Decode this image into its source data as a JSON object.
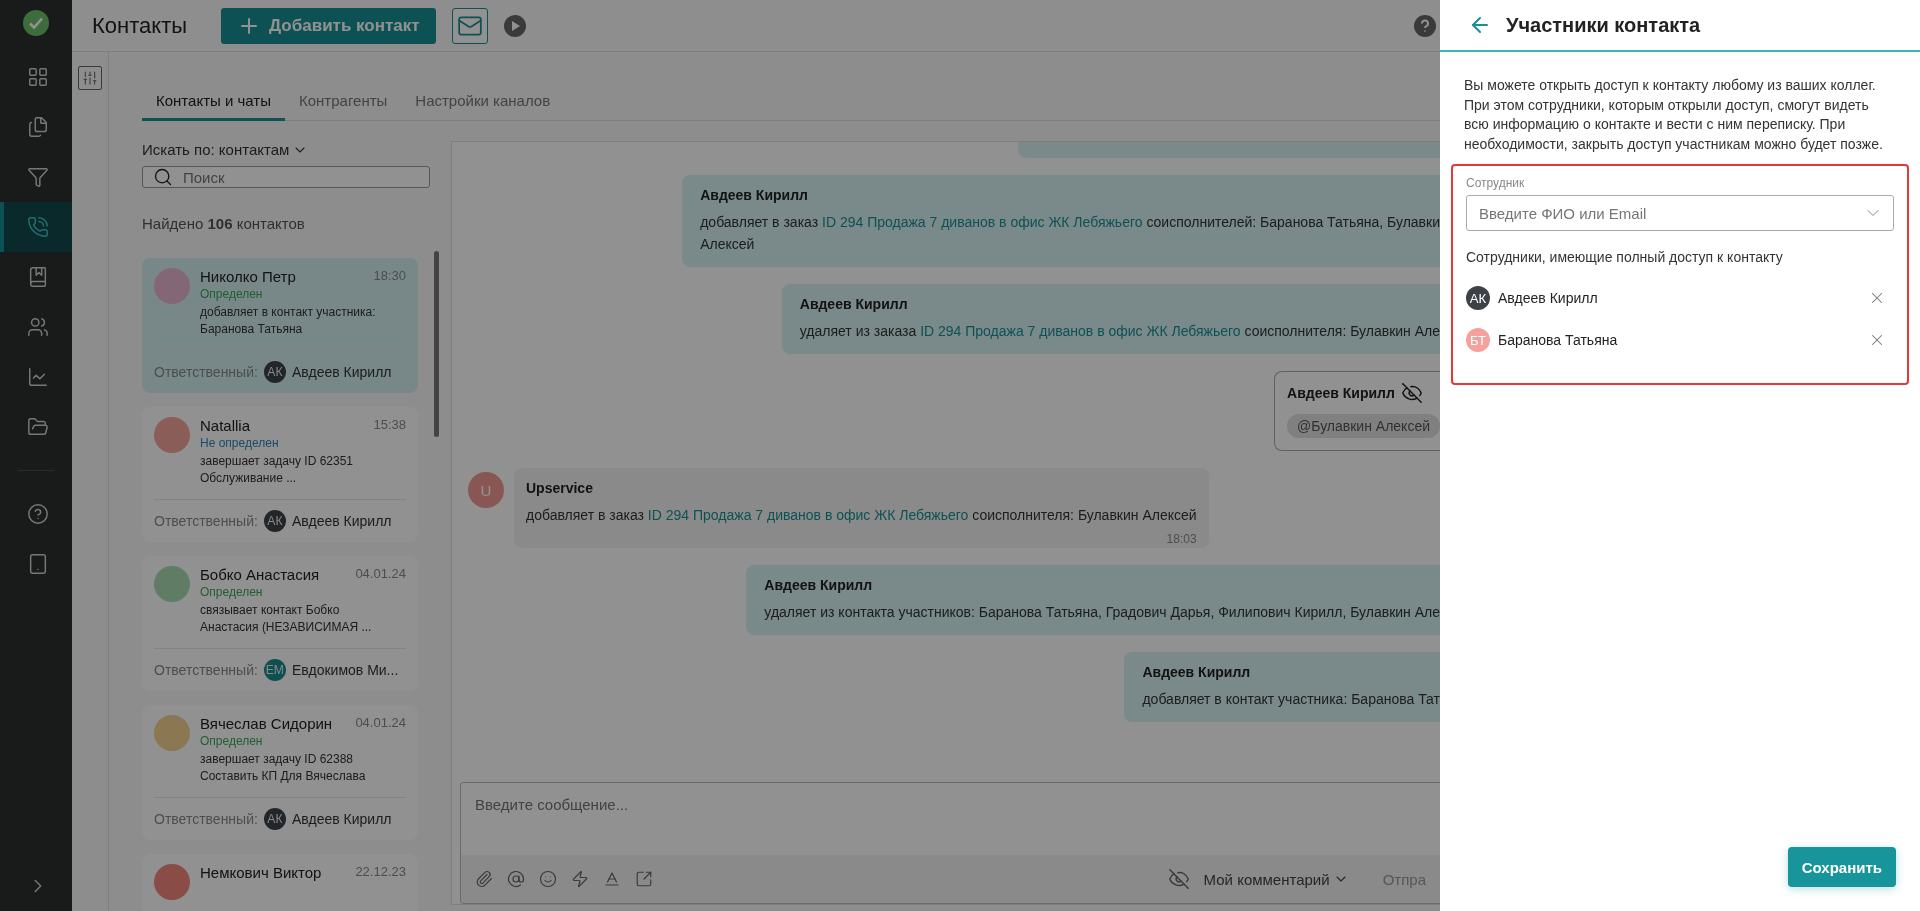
{
  "nav": {
    "items": [
      {
        "kind": "grid",
        "selected": false
      },
      {
        "kind": "documents",
        "selected": false
      },
      {
        "kind": "funnel",
        "selected": false
      },
      {
        "kind": "phone",
        "selected": true
      },
      {
        "kind": "book",
        "selected": false
      },
      {
        "kind": "people",
        "selected": false
      },
      {
        "kind": "chart",
        "selected": false
      },
      {
        "kind": "folder",
        "selected": false
      }
    ],
    "bottom_items": [
      {
        "kind": "help",
        "selected": false
      },
      {
        "kind": "tablet",
        "selected": false
      }
    ]
  },
  "header": {
    "title": "Контакты",
    "add_button": "Добавить контакт"
  },
  "tabs": [
    {
      "label": "Контакты и чаты",
      "selected": true
    },
    {
      "label": "Контрагенты",
      "selected": false
    },
    {
      "label": "Настройки каналов",
      "selected": false
    }
  ],
  "search_by": "Искать по: контактам",
  "search": {
    "placeholder": "Поиск"
  },
  "found": "Найдено **106** контактов",
  "contacts": [
    {
      "name": "Николко Петр",
      "time": "18:30",
      "status": "Определен",
      "known": true,
      "snippet": "добавляет в контакт участника: Баранова Татьяна",
      "color": "#846776",
      "selected": true,
      "responsible_label": "Ответственный:",
      "responsible": {
        "initials": "АК",
        "name": "Авдеев Кирилл",
        "color": "#232629"
      }
    },
    {
      "name": "Natallia",
      "time": "15:38",
      "status": "Не определен",
      "known": false,
      "snippet": "завершает задачу ID 62351 Обслуживание ...",
      "color": "#8a5d59",
      "selected": false,
      "responsible_label": "Ответственный:",
      "responsible": {
        "initials": "АК",
        "name": "Авдеев Кирилл",
        "color": "#232629"
      }
    },
    {
      "name": "Бобко Анастасия",
      "time": "04.01.24",
      "status": "Определен",
      "known": true,
      "snippet": "связывает контакт Бобко Анастасия (НЕЗАВИСИМАЯ ...",
      "color": "#607c65",
      "selected": false,
      "responsible_label": "Ответственный:",
      "responsible": {
        "initials": "ЕМ",
        "name": "Евдокимов Ми...",
        "color": "#0f4f50"
      }
    },
    {
      "name": "Вячеслав Сидорин",
      "time": "04.01.24",
      "status": "Определен",
      "known": true,
      "snippet": "завершает задачу ID 62388 Составить КП Для Вячеслава",
      "color": "#8c7753",
      "selected": false,
      "responsible_label": "Ответственный:",
      "responsible": {
        "initials": "АК",
        "name": "Авдеев Кирилл",
        "color": "#232629"
      }
    },
    {
      "name": "Немкович Виктор",
      "time": "22.12.23",
      "color": "#894c46",
      "selected": false
    }
  ],
  "chat": {
    "messages": [
      {
        "kind": "fragment"
      },
      {
        "kind": "outgoing",
        "author": "Авдеев Кирилл",
        "lines": [
          [
            {
              "text": "добавляет в заказ "
            },
            {
              "text": "ID 294 Продажа 7 диванов в офис ЖК Лебяжьего",
              "link": true
            },
            {
              "text": " соисполнителей: Баранова Татьяна, Булавки"
            }
          ],
          [
            {
              "text": "Алексей"
            }
          ]
        ]
      },
      {
        "kind": "outgoing",
        "author": "Авдеев Кирилл",
        "lines": [
          [
            {
              "text": "удаляет из заказа "
            },
            {
              "text": "ID 294 Продажа 7 диванов в офис ЖК Лебяжьего",
              "link": true
            },
            {
              "text": " соисполнителя: Булавкин Але"
            }
          ]
        ]
      },
      {
        "kind": "comment",
        "author": "Авдеев Кирилл",
        "mention": "@Булавкин Алексей"
      },
      {
        "kind": "incoming",
        "author": "Upservice",
        "initial": "U",
        "time": "18:03",
        "lines": [
          [
            {
              "text": "добавляет в заказ "
            },
            {
              "text": "ID 294 Продажа 7 диванов в офис ЖК Лебяжьего",
              "link": true
            },
            {
              "text": " соисполнителя: Булавкин Алексей"
            }
          ]
        ]
      },
      {
        "kind": "outgoing",
        "author": "Авдеев Кирилл",
        "lines": [
          [
            {
              "text": "удаляет из контакта участников: Баранова Татьяна, Градович Дарья, Филипович Кирилл, Булавкин Але"
            }
          ]
        ]
      },
      {
        "kind": "outgoing",
        "author": "Авдеев Кирилл",
        "lines": [
          [
            {
              "text": "добавляет в контакт участника: Баранова Тат"
            }
          ]
        ]
      }
    ],
    "composer": {
      "placeholder": "Введите сообщение...",
      "mode": "Мой комментарий",
      "send": "Отпра"
    }
  },
  "panel": {
    "title": "Участники контакта",
    "description": "Вы можете открыть доступ к контакту любому из ваших коллег. При этом сотрудники, которым открыли доступ, смогут видеть всю информацию о контакте и вести с ним переписку. При необходимости, закрыть доступ участникам можно будет позже.",
    "field": {
      "label": "Сотрудник",
      "placeholder": "Введите ФИО или Email"
    },
    "members_heading": "Сотрудники, имеющие полный доступ к контакту",
    "members": [
      {
        "initials": "АК",
        "name": "Авдеев Кирилл",
        "color": "#3d4247"
      },
      {
        "initials": "БТ",
        "name": "Баранова Татьяна",
        "color": "#f5a09a"
      }
    ],
    "save": "Сохранить"
  }
}
